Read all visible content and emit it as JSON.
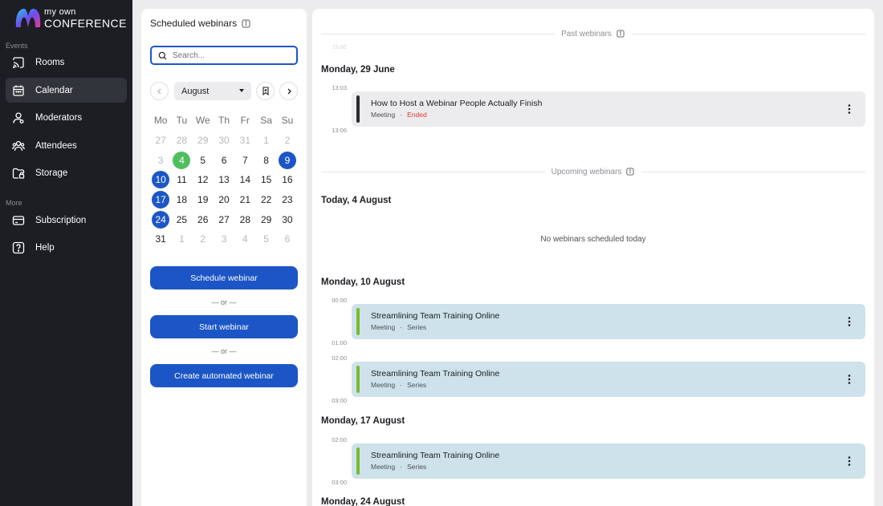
{
  "app": {
    "logo_small": "my own",
    "logo_big": "CONFERENCE"
  },
  "sidebar": {
    "section_events": "Events",
    "section_more": "More",
    "items": [
      {
        "label": "Rooms",
        "icon": "cast-icon"
      },
      {
        "label": "Calendar",
        "icon": "calendar-icon",
        "active": true
      },
      {
        "label": "Moderators",
        "icon": "user-icon"
      },
      {
        "label": "Attendees",
        "icon": "users-icon"
      },
      {
        "label": "Storage",
        "icon": "folder-icon"
      }
    ],
    "more_items": [
      {
        "label": "Subscription",
        "icon": "card-icon"
      },
      {
        "label": "Help",
        "icon": "help-icon"
      }
    ]
  },
  "scheduler": {
    "title": "Scheduled webinars",
    "search_placeholder": "Search...",
    "month": "August",
    "weekdays": [
      "Mo",
      "Tu",
      "We",
      "Th",
      "Fr",
      "Sa",
      "Su"
    ],
    "weeks": [
      [
        "27",
        "28",
        "29",
        "30",
        "31",
        "1",
        "2"
      ],
      [
        "3",
        "4",
        "5",
        "6",
        "7",
        "8",
        "9"
      ],
      [
        "10",
        "11",
        "12",
        "13",
        "14",
        "15",
        "16"
      ],
      [
        "17",
        "18",
        "19",
        "20",
        "21",
        "22",
        "23"
      ],
      [
        "24",
        "25",
        "26",
        "27",
        "28",
        "29",
        "30"
      ],
      [
        "31",
        "1",
        "2",
        "3",
        "4",
        "5",
        "6"
      ]
    ],
    "schedule_button": "Schedule webinar",
    "or_text": "— or —",
    "start_button": "Start webinar",
    "automated_button": "Create automated webinar"
  },
  "main": {
    "past_label": "Past webinars",
    "upcoming_label": "Upcoming webinars",
    "faded_time": "15:00",
    "past_day": "Monday, 29 June",
    "past_event": {
      "start": "13:03",
      "end": "13:06",
      "title": "How to Host a Webinar People Actually Finish",
      "type": "Meeting",
      "status": "Ended"
    },
    "today_heading": "Today, 4 August",
    "today_empty": "No webinars scheduled today",
    "days": [
      {
        "heading": "Monday, 10 August",
        "events": [
          {
            "start": "00:00",
            "end": "01:00",
            "title": "Streamlining Team Training Online",
            "type": "Meeting",
            "kind": "Series"
          },
          {
            "start": "02:00",
            "end": "03:00",
            "title": "Streamlining Team Training Online",
            "type": "Meeting",
            "kind": "Series"
          }
        ]
      },
      {
        "heading": "Monday, 17 August",
        "events": [
          {
            "start": "02:00",
            "end": "03:00",
            "title": "Streamlining Team Training Online",
            "type": "Meeting",
            "kind": "Series"
          }
        ]
      },
      {
        "heading": "Monday, 24 August",
        "events": []
      }
    ],
    "meta_separator": "·"
  },
  "colors": {
    "sidebar_bg": "#1c1e24",
    "accent_blue": "#1c56c6",
    "today_green": "#4fbf5e",
    "upcoming_bar": "#7cb82f",
    "past_bar": "#2a2b30",
    "ended_red": "#e53935",
    "event_bg": "#cde2ea"
  }
}
